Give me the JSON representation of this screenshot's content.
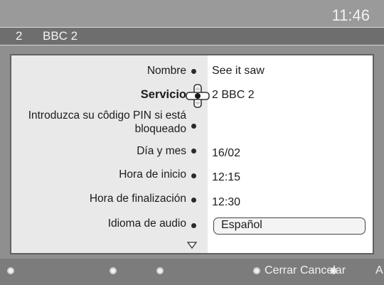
{
  "header": {
    "clock": "11:46"
  },
  "channel": {
    "number": "2",
    "name": "BBC 2"
  },
  "form": {
    "rows": [
      {
        "label": "Nombre",
        "value": "See it saw"
      },
      {
        "label": "Servicio",
        "value": "2 BBC 2"
      },
      {
        "label": "Introduzca su côdigo PIN si está bloqueado",
        "value": ""
      },
      {
        "label": "Día y mes",
        "value": "16/02"
      },
      {
        "label": "Hora de inicio",
        "value": "12:15"
      },
      {
        "label": "Hora de finalización",
        "value": "12:30"
      },
      {
        "label": "Idioma de audio",
        "value": "Español"
      }
    ]
  },
  "footer": {
    "close_label": "Cerrar",
    "cancel_label": "Cancelar",
    "extra_label": "A"
  },
  "icons": {
    "nav": "navigation-cross-icon",
    "scroll": "scroll-down-arrow-icon",
    "bullet": "bullet-icon"
  }
}
